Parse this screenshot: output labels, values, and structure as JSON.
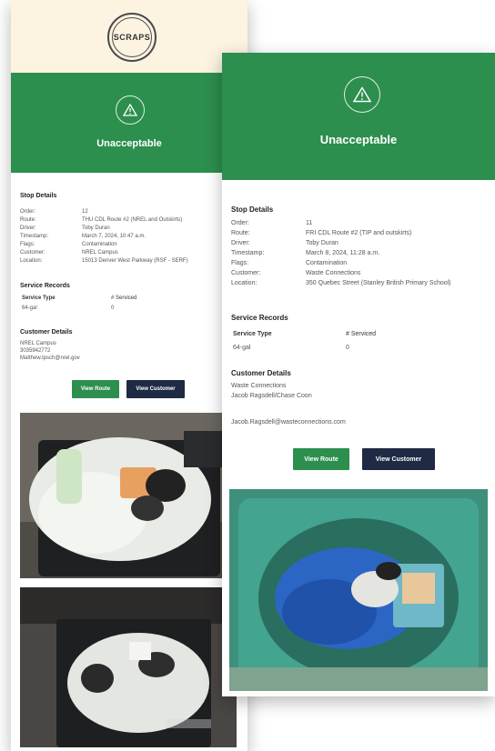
{
  "back": {
    "logo_text": "SCRAPS",
    "status": "Unacceptable",
    "stop_details_title": "Stop Details",
    "stop_details": [
      {
        "label": "Order:",
        "value": "12"
      },
      {
        "label": "Route:",
        "value": "THU CDL Route #2 (NREL and Outskirts)"
      },
      {
        "label": "Driver:",
        "value": "Toby Duran"
      },
      {
        "label": "Timestamp:",
        "value": "March 7, 2024, 10:47 a.m."
      },
      {
        "label": "Flags:",
        "value": "Contamination"
      },
      {
        "label": "Customer:",
        "value": "NREL Campus"
      },
      {
        "label": "Location:",
        "value": "15013 Denver West Parkway (RSF - SERF)"
      }
    ],
    "service_records_title": "Service Records",
    "service_header": {
      "type": "Service Type",
      "count": "# Serviced"
    },
    "service_rows": [
      {
        "type": "64-gal",
        "count": "0"
      }
    ],
    "customer_details_title": "Customer Details",
    "customer_lines": [
      "NREL Campus",
      "3035942772"
    ],
    "customer_email": "Matthew.Ipsch@nrel.gov",
    "view_route": "View Route",
    "view_customer": "View Customer"
  },
  "front": {
    "status": "Unacceptable",
    "stop_details_title": "Stop Details",
    "stop_details": [
      {
        "label": "Order:",
        "value": "11"
      },
      {
        "label": "Route:",
        "value": "FRI CDL Route #2 (TIP and outskirts)"
      },
      {
        "label": "Driver:",
        "value": "Toby Duran"
      },
      {
        "label": "Timestamp:",
        "value": "March 8, 2024, 11:28 a.m."
      },
      {
        "label": "Flags:",
        "value": "Contamination"
      },
      {
        "label": "Customer:",
        "value": "Waste Connections"
      },
      {
        "label": "Location:",
        "value": "350 Quebec Street (Stanley British Primary School)"
      }
    ],
    "service_records_title": "Service Records",
    "service_header": {
      "type": "Service Type",
      "count": "# Serviced"
    },
    "service_rows": [
      {
        "type": "64-gal",
        "count": "0"
      }
    ],
    "customer_details_title": "Customer Details",
    "customer_lines": [
      "Waste Connections",
      "Jacob Ragsdell/Chase Coon"
    ],
    "customer_email": "Jacob.Ragsdell@wasteconnections.com",
    "view_route": "View Route",
    "view_customer": "View Customer"
  },
  "colors": {
    "brand_green": "#2c8f4e",
    "navy": "#1f2a44",
    "link_blue": "#2d6fc4",
    "logo_cream": "#fcf3e1"
  },
  "icons": [
    "warning-icon"
  ]
}
